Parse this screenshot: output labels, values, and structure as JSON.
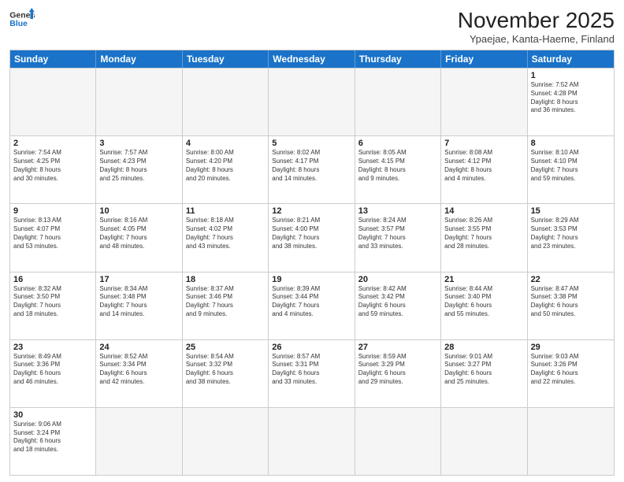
{
  "header": {
    "logo_general": "General",
    "logo_blue": "Blue",
    "month_title": "November 2025",
    "location": "Ypaejae, Kanta-Haeme, Finland"
  },
  "days_of_week": [
    "Sunday",
    "Monday",
    "Tuesday",
    "Wednesday",
    "Thursday",
    "Friday",
    "Saturday"
  ],
  "rows": [
    {
      "cells": [
        {
          "day": "",
          "empty": true
        },
        {
          "day": "",
          "empty": true
        },
        {
          "day": "",
          "empty": true
        },
        {
          "day": "",
          "empty": true
        },
        {
          "day": "",
          "empty": true
        },
        {
          "day": "",
          "empty": true
        },
        {
          "day": "1",
          "text": "Sunrise: 7:52 AM\nSunset: 4:28 PM\nDaylight: 8 hours\nand 36 minutes."
        }
      ]
    },
    {
      "cells": [
        {
          "day": "2",
          "text": "Sunrise: 7:54 AM\nSunset: 4:25 PM\nDaylight: 8 hours\nand 30 minutes."
        },
        {
          "day": "3",
          "text": "Sunrise: 7:57 AM\nSunset: 4:23 PM\nDaylight: 8 hours\nand 25 minutes."
        },
        {
          "day": "4",
          "text": "Sunrise: 8:00 AM\nSunset: 4:20 PM\nDaylight: 8 hours\nand 20 minutes."
        },
        {
          "day": "5",
          "text": "Sunrise: 8:02 AM\nSunset: 4:17 PM\nDaylight: 8 hours\nand 14 minutes."
        },
        {
          "day": "6",
          "text": "Sunrise: 8:05 AM\nSunset: 4:15 PM\nDaylight: 8 hours\nand 9 minutes."
        },
        {
          "day": "7",
          "text": "Sunrise: 8:08 AM\nSunset: 4:12 PM\nDaylight: 8 hours\nand 4 minutes."
        },
        {
          "day": "8",
          "text": "Sunrise: 8:10 AM\nSunset: 4:10 PM\nDaylight: 7 hours\nand 59 minutes."
        }
      ]
    },
    {
      "cells": [
        {
          "day": "9",
          "text": "Sunrise: 8:13 AM\nSunset: 4:07 PM\nDaylight: 7 hours\nand 53 minutes."
        },
        {
          "day": "10",
          "text": "Sunrise: 8:16 AM\nSunset: 4:05 PM\nDaylight: 7 hours\nand 48 minutes."
        },
        {
          "day": "11",
          "text": "Sunrise: 8:18 AM\nSunset: 4:02 PM\nDaylight: 7 hours\nand 43 minutes."
        },
        {
          "day": "12",
          "text": "Sunrise: 8:21 AM\nSunset: 4:00 PM\nDaylight: 7 hours\nand 38 minutes."
        },
        {
          "day": "13",
          "text": "Sunrise: 8:24 AM\nSunset: 3:57 PM\nDaylight: 7 hours\nand 33 minutes."
        },
        {
          "day": "14",
          "text": "Sunrise: 8:26 AM\nSunset: 3:55 PM\nDaylight: 7 hours\nand 28 minutes."
        },
        {
          "day": "15",
          "text": "Sunrise: 8:29 AM\nSunset: 3:53 PM\nDaylight: 7 hours\nand 23 minutes."
        }
      ]
    },
    {
      "cells": [
        {
          "day": "16",
          "text": "Sunrise: 8:32 AM\nSunset: 3:50 PM\nDaylight: 7 hours\nand 18 minutes."
        },
        {
          "day": "17",
          "text": "Sunrise: 8:34 AM\nSunset: 3:48 PM\nDaylight: 7 hours\nand 14 minutes."
        },
        {
          "day": "18",
          "text": "Sunrise: 8:37 AM\nSunset: 3:46 PM\nDaylight: 7 hours\nand 9 minutes."
        },
        {
          "day": "19",
          "text": "Sunrise: 8:39 AM\nSunset: 3:44 PM\nDaylight: 7 hours\nand 4 minutes."
        },
        {
          "day": "20",
          "text": "Sunrise: 8:42 AM\nSunset: 3:42 PM\nDaylight: 6 hours\nand 59 minutes."
        },
        {
          "day": "21",
          "text": "Sunrise: 8:44 AM\nSunset: 3:40 PM\nDaylight: 6 hours\nand 55 minutes."
        },
        {
          "day": "22",
          "text": "Sunrise: 8:47 AM\nSunset: 3:38 PM\nDaylight: 6 hours\nand 50 minutes."
        }
      ]
    },
    {
      "cells": [
        {
          "day": "23",
          "text": "Sunrise: 8:49 AM\nSunset: 3:36 PM\nDaylight: 6 hours\nand 46 minutes."
        },
        {
          "day": "24",
          "text": "Sunrise: 8:52 AM\nSunset: 3:34 PM\nDaylight: 6 hours\nand 42 minutes."
        },
        {
          "day": "25",
          "text": "Sunrise: 8:54 AM\nSunset: 3:32 PM\nDaylight: 6 hours\nand 38 minutes."
        },
        {
          "day": "26",
          "text": "Sunrise: 8:57 AM\nSunset: 3:31 PM\nDaylight: 6 hours\nand 33 minutes."
        },
        {
          "day": "27",
          "text": "Sunrise: 8:59 AM\nSunset: 3:29 PM\nDaylight: 6 hours\nand 29 minutes."
        },
        {
          "day": "28",
          "text": "Sunrise: 9:01 AM\nSunset: 3:27 PM\nDaylight: 6 hours\nand 25 minutes."
        },
        {
          "day": "29",
          "text": "Sunrise: 9:03 AM\nSunset: 3:26 PM\nDaylight: 6 hours\nand 22 minutes."
        }
      ]
    },
    {
      "cells": [
        {
          "day": "30",
          "text": "Sunrise: 9:06 AM\nSunset: 3:24 PM\nDaylight: 6 hours\nand 18 minutes."
        },
        {
          "day": "",
          "empty": true
        },
        {
          "day": "",
          "empty": true
        },
        {
          "day": "",
          "empty": true
        },
        {
          "day": "",
          "empty": true
        },
        {
          "day": "",
          "empty": true
        },
        {
          "day": "",
          "empty": true
        }
      ]
    }
  ]
}
